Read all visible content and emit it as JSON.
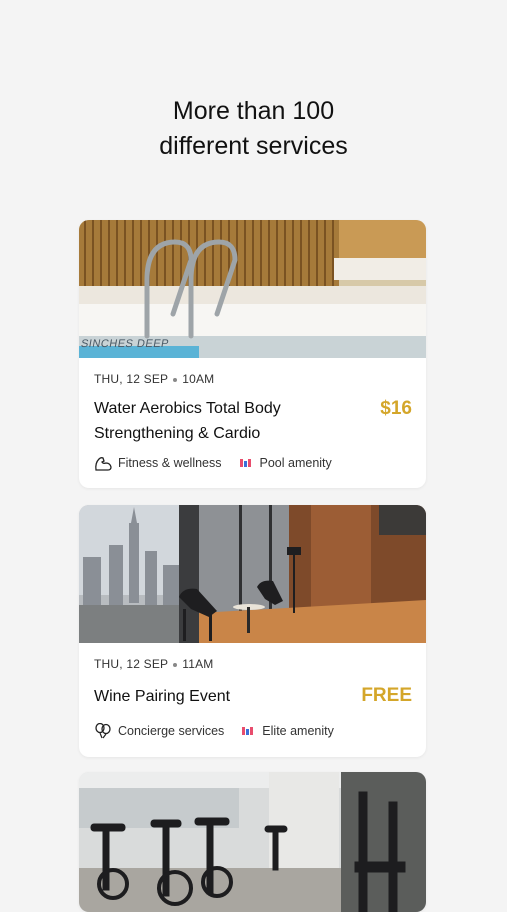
{
  "headline": {
    "line1": "More than 100",
    "line2": "different services"
  },
  "cards": [
    {
      "meta": {
        "day": "THU, 12 SEP",
        "time": "10AM"
      },
      "title_line1": "Water Aerobics Total Body",
      "title_line2": "Strengthening & Cardio",
      "price": "$16",
      "category": {
        "icon": "flexed-arm-icon",
        "label": "Fitness & wellness"
      },
      "amenity": {
        "icon": "amenity-bars-icon",
        "label": "Pool amenity"
      },
      "photo_sign": "SINCHES DEEP"
    },
    {
      "meta": {
        "day": "THU, 12 SEP",
        "time": "11AM"
      },
      "title_line1": "Wine Pairing Event",
      "price": "FREE",
      "category": {
        "icon": "balloons-icon",
        "label": "Concierge services"
      },
      "amenity": {
        "icon": "amenity-bars-icon",
        "label": "Elite amenity"
      }
    }
  ],
  "colors": {
    "price": "#d4a62a",
    "background": "#f4f4f4",
    "amenity_red": "#e84d6d",
    "amenity_blue": "#3a6fd8"
  }
}
